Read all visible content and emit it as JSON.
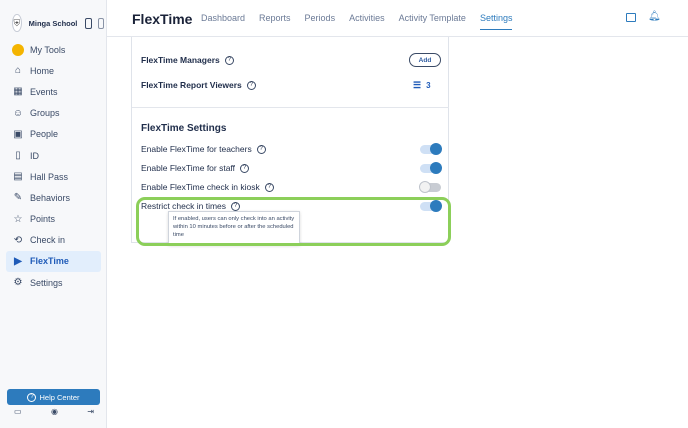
{
  "sidebar": {
    "school_name": "Minga School",
    "school_logo_icon": "school-crest-icon",
    "items": [
      {
        "label": "My Tools",
        "icon": "mytools-avatar-icon"
      },
      {
        "label": "Home",
        "icon": "home-icon"
      },
      {
        "label": "Events",
        "icon": "calendar-icon"
      },
      {
        "label": "Groups",
        "icon": "groups-icon"
      },
      {
        "label": "People",
        "icon": "person-card-icon"
      },
      {
        "label": "ID",
        "icon": "id-badge-icon"
      },
      {
        "label": "Hall Pass",
        "icon": "hall-pass-icon"
      },
      {
        "label": "Behaviors",
        "icon": "behaviors-icon"
      },
      {
        "label": "Points",
        "icon": "star-icon"
      },
      {
        "label": "Check in",
        "icon": "checkin-icon"
      },
      {
        "label": "FlexTime",
        "icon": "flextime-icon",
        "active": true
      },
      {
        "label": "Settings",
        "icon": "gear-icon"
      }
    ],
    "help_label": "Help Center"
  },
  "topbar": {
    "brand": "FlexTime",
    "tabs": [
      "Dashboard",
      "Reports",
      "Periods",
      "Activities",
      "Activity Template",
      "Settings"
    ],
    "active_tab": "Settings"
  },
  "panel": {
    "managers_label": "FlexTime Managers",
    "add_label": "Add",
    "viewers_label": "FlexTime Report Viewers",
    "viewers_count": "3",
    "settings_title": "FlexTime Settings",
    "settings": [
      {
        "label": "Enable FlexTime for teachers",
        "enabled": true
      },
      {
        "label": "Enable FlexTime for staff",
        "enabled": true
      },
      {
        "label": "Enable FlexTime check in kiosk",
        "enabled": false
      },
      {
        "label": "Restrict check in times",
        "enabled": true
      }
    ],
    "tooltip": "If enabled, users can only check into an activity within 10 minutes before or after the scheduled time"
  },
  "colors": {
    "accent": "#2d7bbd",
    "highlight": "#8ccf5a",
    "active_nav_bg": "#e2eefc"
  }
}
